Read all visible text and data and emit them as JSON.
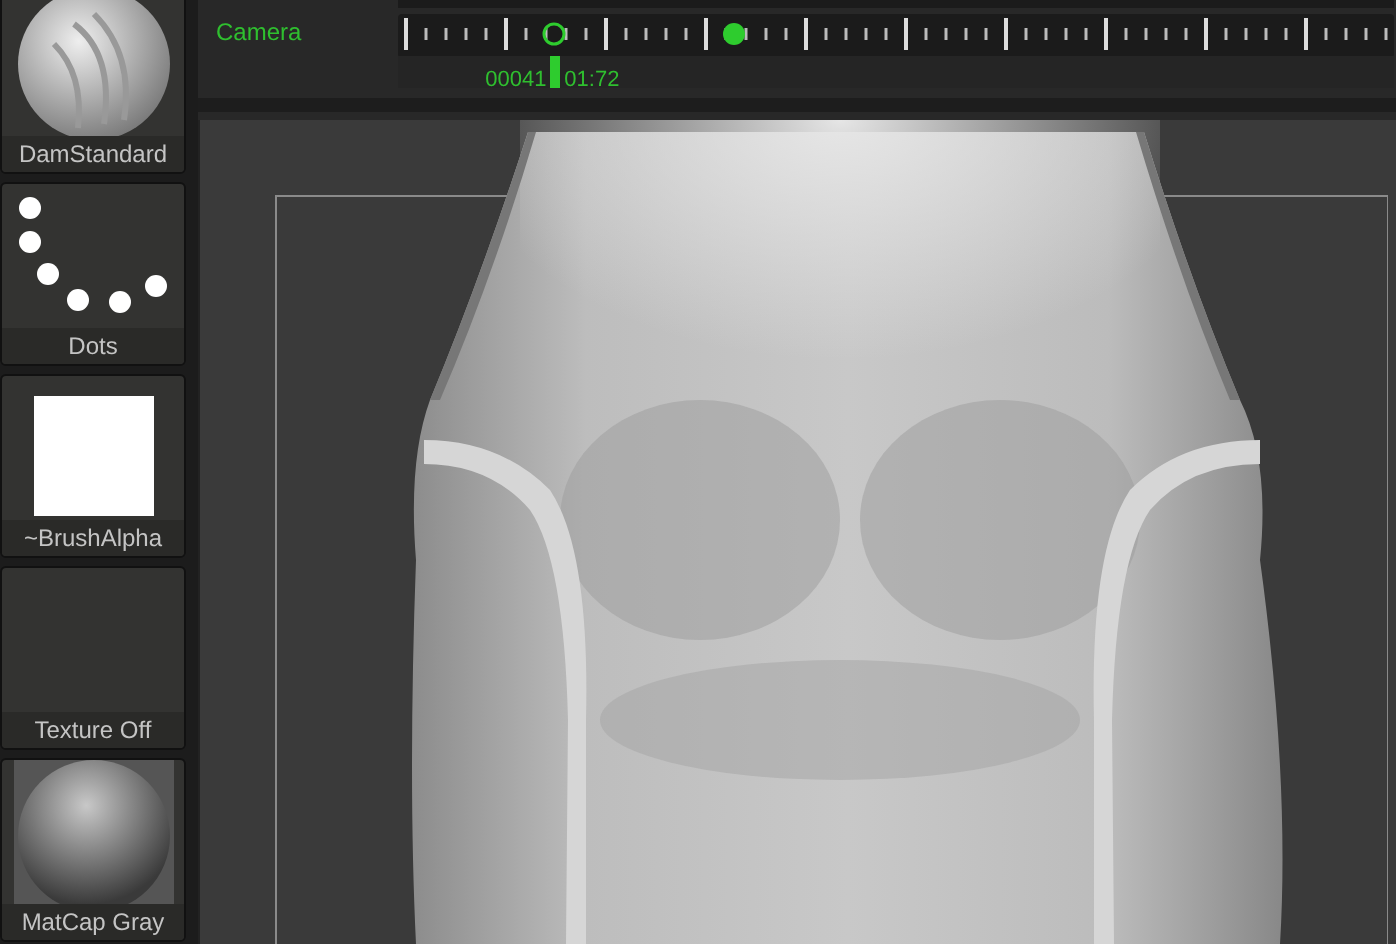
{
  "tiles": [
    {
      "kind": "brush",
      "label": "DamStandard"
    },
    {
      "kind": "dots",
      "label": "Dots"
    },
    {
      "kind": "square",
      "label": "~BrushAlpha"
    },
    {
      "kind": "empty",
      "label": "Texture Off"
    },
    {
      "kind": "matcap",
      "label": "MatCap Gray"
    }
  ],
  "timeline": {
    "label": "Camera",
    "frame": "00041",
    "time": "01:72",
    "level": 0.157
  }
}
